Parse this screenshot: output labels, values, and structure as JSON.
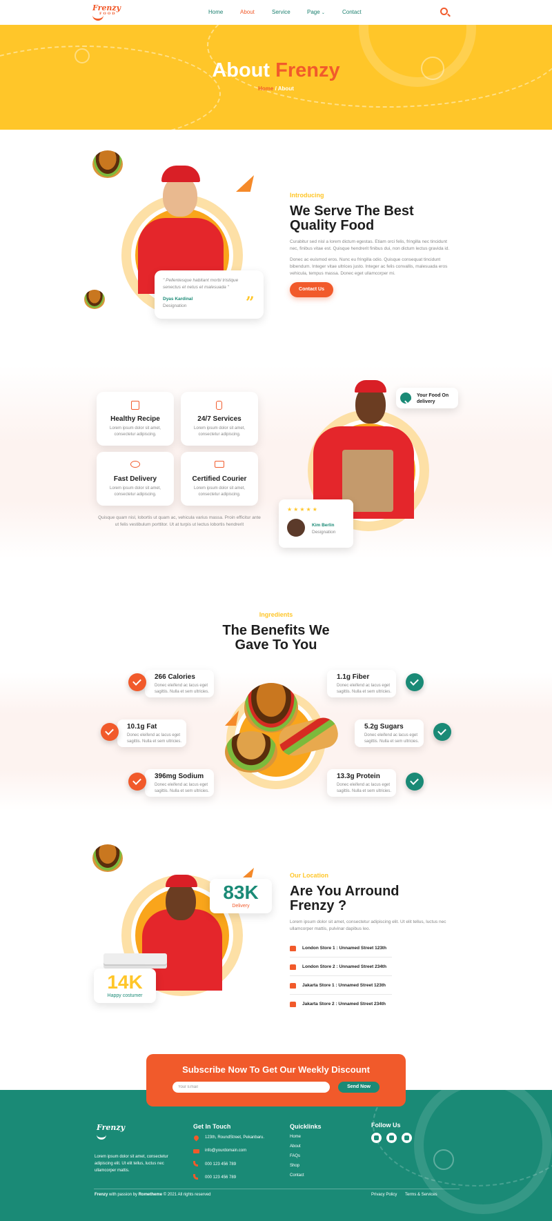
{
  "colors": {
    "brand_orange": "#f15a2b",
    "brand_yellow": "#ffc629",
    "brand_green": "#1a8a76"
  },
  "nav": {
    "logo": "Frenzy",
    "logo_sub": "FOOD",
    "links": [
      "Home",
      "About",
      "Service",
      "Page",
      "Contact"
    ],
    "active": "About",
    "dropdown_icon": "chevron-down-icon",
    "search_icon": "search-icon"
  },
  "banner": {
    "title_part1": "About",
    "title_part2": "Frenzy",
    "crumb_home": "Home",
    "crumb_sep": "/",
    "crumb_current": "About"
  },
  "intro": {
    "eyebrow": "Introducing",
    "heading_line1": "We Serve The Best",
    "heading_line2": "Quality Food",
    "para1": "Curabitur sed nisl a lorem dictum egestas. Etiam orci felis, fringilla nec tincidunt nec, finibus vitae est. Quisque hendrerit finibus dui, non dictum lectus gravida id.",
    "para2": "Donec ac euismod eros. Nunc eu fringilla odio. Quisque consequat tincidunt bibendum. Integer vitae ultrices justo. Integer ac felis convallis, malesuada eros vehicula, tempus massa. Donec eget ullamcorper mi.",
    "button": "Contact Us",
    "quote": "\" Pellentesque habitant morbi tristique senectus et netus et malesuada \"",
    "quote_name": "Dyas Kardinal",
    "quote_role": "Designation",
    "quote_icon": "quote-icon"
  },
  "features": {
    "cards": [
      {
        "title": "Healthy Recipe",
        "text": "Lorem ipsum dolor sit amet, consectetur adipiscing.",
        "icon": "recipe-icon"
      },
      {
        "title": "24/7 Services",
        "text": "Lorem ipsum dolor sit amet, consectetur adipiscing.",
        "icon": "phone-icon"
      },
      {
        "title": "Fast Delivery",
        "text": "Lorem ipsum dolor sit amet, consectetur adipiscing.",
        "icon": "delivery-icon"
      },
      {
        "title": "Certified Courier",
        "text": "Lorem ipsum dolor sit amet, consectetur adipiscing.",
        "icon": "certificate-icon"
      }
    ],
    "footnote": "Quisque quam nisl, lobortis ut quam ac, vehicula varius massa. Proin efficitur ante ut felis vestibulum porttitor. Ut at turpis ut lectus lobortis hendrerit",
    "badge": "Your Food On delivery",
    "review_name": "Kim Berlin",
    "review_role": "Designation",
    "review_stars": 5
  },
  "benefits": {
    "eyebrow": "Ingredients",
    "heading_line1": "The Benefits We",
    "heading_line2": "Gave To You",
    "items": [
      {
        "title": "266 Calories",
        "text": "Donec eleifend ac lacus eget sagittis. Nulla et sem ultricies."
      },
      {
        "title": "10.1g Fat",
        "text": "Donec eleifend ac lacus eget sagittis. Nulla et sem ultricies."
      },
      {
        "title": "396mg Sodium",
        "text": "Donec eleifend ac lacus eget sagittis. Nulla et sem ultricies."
      },
      {
        "title": "1.1g Fiber",
        "text": "Donec eleifend ac lacus eget sagittis. Nulla et sem ultricies."
      },
      {
        "title": "5.2g Sugars",
        "text": "Donec eleifend ac lacus eget sagittis. Nulla et sem ultricies."
      },
      {
        "title": "13.3g Protein",
        "text": "Donec eleifend ac lacus eget sagittis. Nulla et sem ultricies."
      }
    ]
  },
  "location": {
    "eyebrow": "Our Location",
    "heading_line1": "Are You Arround",
    "heading_line2": "Frenzy ?",
    "para": "Lorem ipsum dolor sit amet, consectetur adipiscing elit. Ut elit tellus, luctus nec ullamcorper mattis, pulvinar dapibus leo.",
    "stat1_value": "83K",
    "stat1_label": "Delivery",
    "stat2_value": "14K",
    "stat2_label": "Happy costumer",
    "stores": [
      "London Store 1 : Unnamed Street 123th",
      "London Store 2 : Unnamed Street 234th",
      "Jakarta Store 1 : Unnamed Street 123th",
      "Jakarta Store 2 : Unnamed Street 234th"
    ]
  },
  "subscribe": {
    "title": "Subscribe Now To Get Our Weekly Discount",
    "placeholder": "Your Email",
    "button": "Send Now"
  },
  "footer": {
    "logo": "Frenzy",
    "about": "Lorem ipsum dolor sit amet, consectetur adipiscing elit. Ut elit tellus, luctus nec ullamcorper mattis.",
    "contact_title": "Get In Touch",
    "address": "123th, RoundStreet, Pekanbaru.",
    "email": "info@yourdomain.com",
    "phone1": "000 123 456 789",
    "phone2": "000 123 456 789",
    "links_title": "Quicklinks",
    "links": [
      "Home",
      "About",
      "FAQs",
      "Shop",
      "Contact"
    ],
    "follow_title": "Follow Us",
    "socials": [
      "facebook-icon",
      "twitter-icon",
      "youtube-icon"
    ],
    "copy_brand": "Frenzy",
    "copy_mid": " with passion by ",
    "copy_author": "Rometheme",
    "copy_end": " © 2021 All rights reserved",
    "privacy": "Privacy Policy",
    "terms": "Terms & Services"
  }
}
